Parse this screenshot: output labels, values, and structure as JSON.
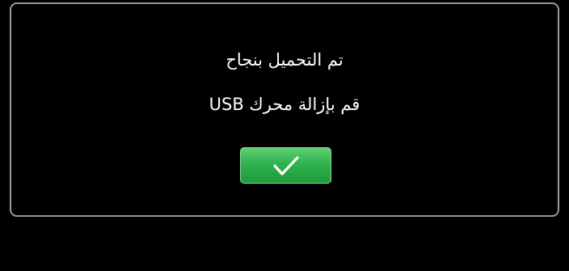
{
  "dialog": {
    "message_line_1": "تم التحميل بنجاح",
    "message_line_2": "قم بإزالة محرك USB",
    "confirm_icon": "checkmark-icon"
  },
  "colors": {
    "background": "#000000",
    "dialog_border": "#9a9a9a",
    "text": "#ffffff",
    "button_green": "#2fb24e"
  }
}
